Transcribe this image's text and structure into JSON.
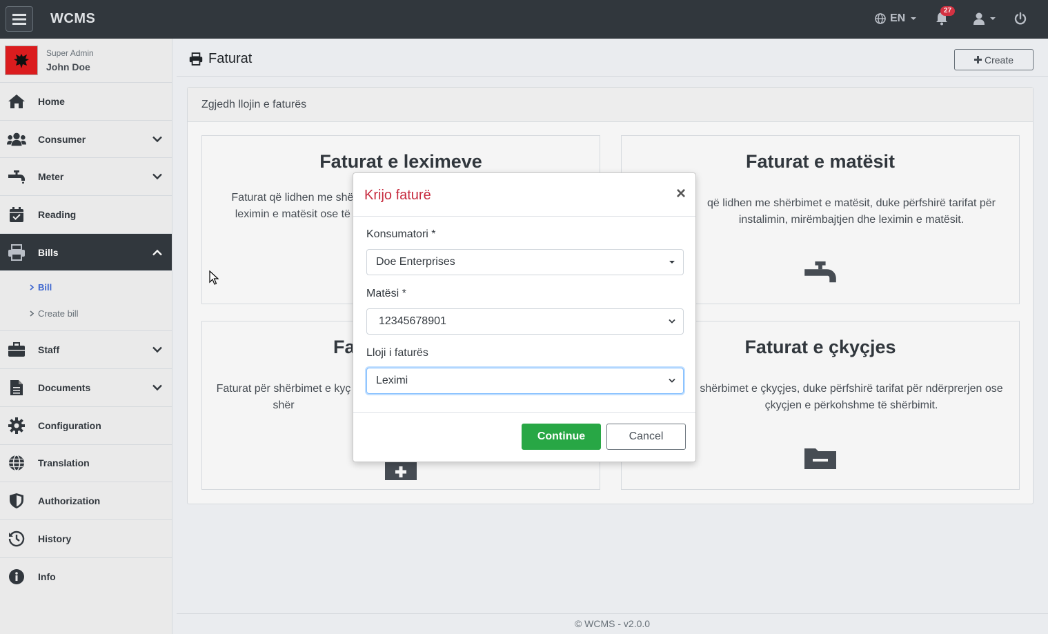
{
  "app": {
    "brand": "WCMS",
    "language": "EN",
    "notification_count": "27"
  },
  "user": {
    "role": "Super Admin",
    "name": "John Doe"
  },
  "sidebar": {
    "items": [
      {
        "label": "Home",
        "icon": "home-icon"
      },
      {
        "label": "Consumer",
        "icon": "users-icon"
      },
      {
        "label": "Meter",
        "icon": "faucet-icon"
      },
      {
        "label": "Reading",
        "icon": "calendar-check-icon"
      },
      {
        "label": "Bills",
        "icon": "printer-icon"
      },
      {
        "label": "Staff",
        "icon": "briefcase-icon"
      },
      {
        "label": "Documents",
        "icon": "file-icon"
      },
      {
        "label": "Configuration",
        "icon": "gear-icon"
      },
      {
        "label": "Translation",
        "icon": "globe-icon"
      },
      {
        "label": "Authorization",
        "icon": "shield-icon"
      },
      {
        "label": "History",
        "icon": "history-icon"
      },
      {
        "label": "Info",
        "icon": "info-icon"
      }
    ],
    "bills_sub": [
      {
        "label": "Bill"
      },
      {
        "label": "Create bill"
      }
    ]
  },
  "page": {
    "title": "Faturat",
    "create_label": "Create",
    "card_header": "Zgjedh llojin e faturës"
  },
  "tiles": [
    {
      "title": "Faturat e leximeve",
      "text": "Faturat që lidhen me shërb leximin e matësit ose të d"
    },
    {
      "title": "Faturat e matësit",
      "text": "që lidhen me shërbimet e matësit, duke përfshirë tarifat për instalimin, mirëmbajtjen dhe leximin e matësit."
    },
    {
      "title": "Fa",
      "text": "Faturat për shërbimet e kyç shër"
    },
    {
      "title": "Faturat e çkyçjes",
      "text": "shërbimet e çkyçjes, duke përfshirë tarifat për ndërprerjen ose çkyçjen e përkohshme të shërbimit."
    }
  ],
  "modal": {
    "title": "Krijo faturë",
    "close": "×",
    "consumer_label": "Konsumatori *",
    "consumer_value": "Doe Enterprises",
    "meter_label": "Matësi *",
    "meter_value": "12345678901",
    "type_label": "Lloji i faturës",
    "type_value": "Leximi",
    "continue": "Continue",
    "cancel": "Cancel"
  },
  "footer": "© WCMS - v2.0.0",
  "colors": {
    "topbar": "#343a40",
    "accent_red": "#c72c3f",
    "success": "#28a745",
    "link": "#3f6ad8"
  }
}
